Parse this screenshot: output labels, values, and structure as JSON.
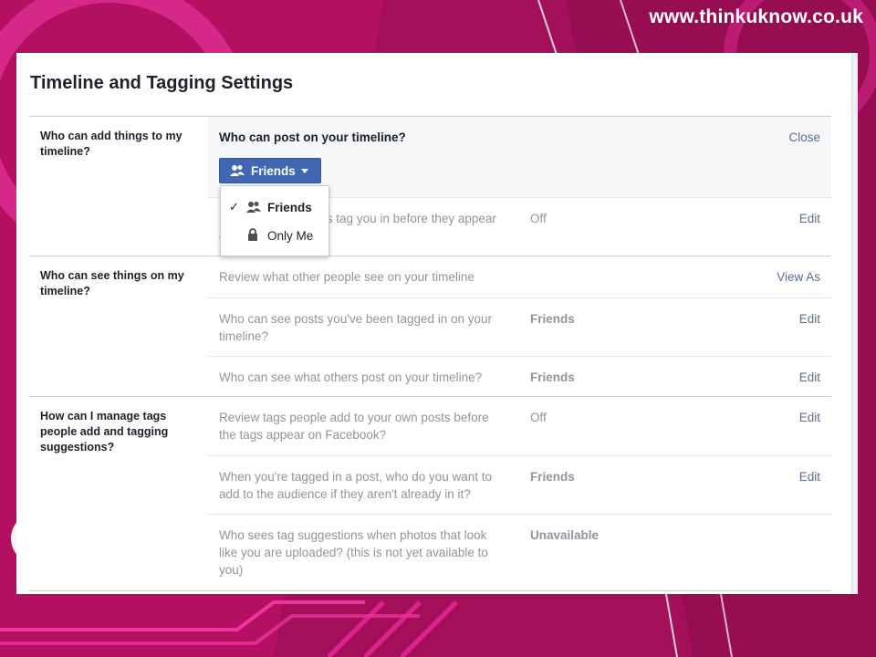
{
  "site_url": "www.thinkuknow.co.uk",
  "panel": {
    "title": "Timeline and Tagging Settings"
  },
  "sections": [
    {
      "label": "Who can add things to my timeline?",
      "rows": [
        {
          "question": "Who can post on your timeline?",
          "action": "Close",
          "expanded": true,
          "audience_button": {
            "label": "Friends",
            "icon": "friends-icon"
          },
          "dropdown": {
            "options": [
              {
                "label": "Friends",
                "icon": "friends-icon",
                "selected": true
              },
              {
                "label": "Only Me",
                "icon": "lock-icon",
                "selected": false
              }
            ]
          }
        },
        {
          "question": "Review posts friends tag you in before they appear on your timeline?",
          "value": "Off",
          "action": "Edit"
        }
      ]
    },
    {
      "label": "Who can see things on my timeline?",
      "rows": [
        {
          "question": "Review what other people see on your timeline",
          "value": "",
          "action": "View As"
        },
        {
          "question": "Who can see posts you've been tagged in on your timeline?",
          "value": "Friends",
          "action": "Edit"
        },
        {
          "question": "Who can see what others post on your timeline?",
          "value": "Friends",
          "action": "Edit"
        }
      ]
    },
    {
      "label": "How can I manage tags people add and tagging suggestions?",
      "rows": [
        {
          "question": "Review tags people add to your own posts before the tags appear on Facebook?",
          "value": "Off",
          "action": "Edit"
        },
        {
          "question": "When you're tagged in a post, who do you want to add to the audience if they aren't already in it?",
          "value": "Friends",
          "action": "Edit"
        },
        {
          "question": "Who sees tag suggestions when photos that look like you are uploaded? (this is not yet available to you)",
          "value": "Unavailable",
          "action": ""
        }
      ]
    }
  ],
  "colors": {
    "background": "#b0105e",
    "button": "#4267b2",
    "link": "#5b6d93",
    "muted_text": "#90949c"
  }
}
